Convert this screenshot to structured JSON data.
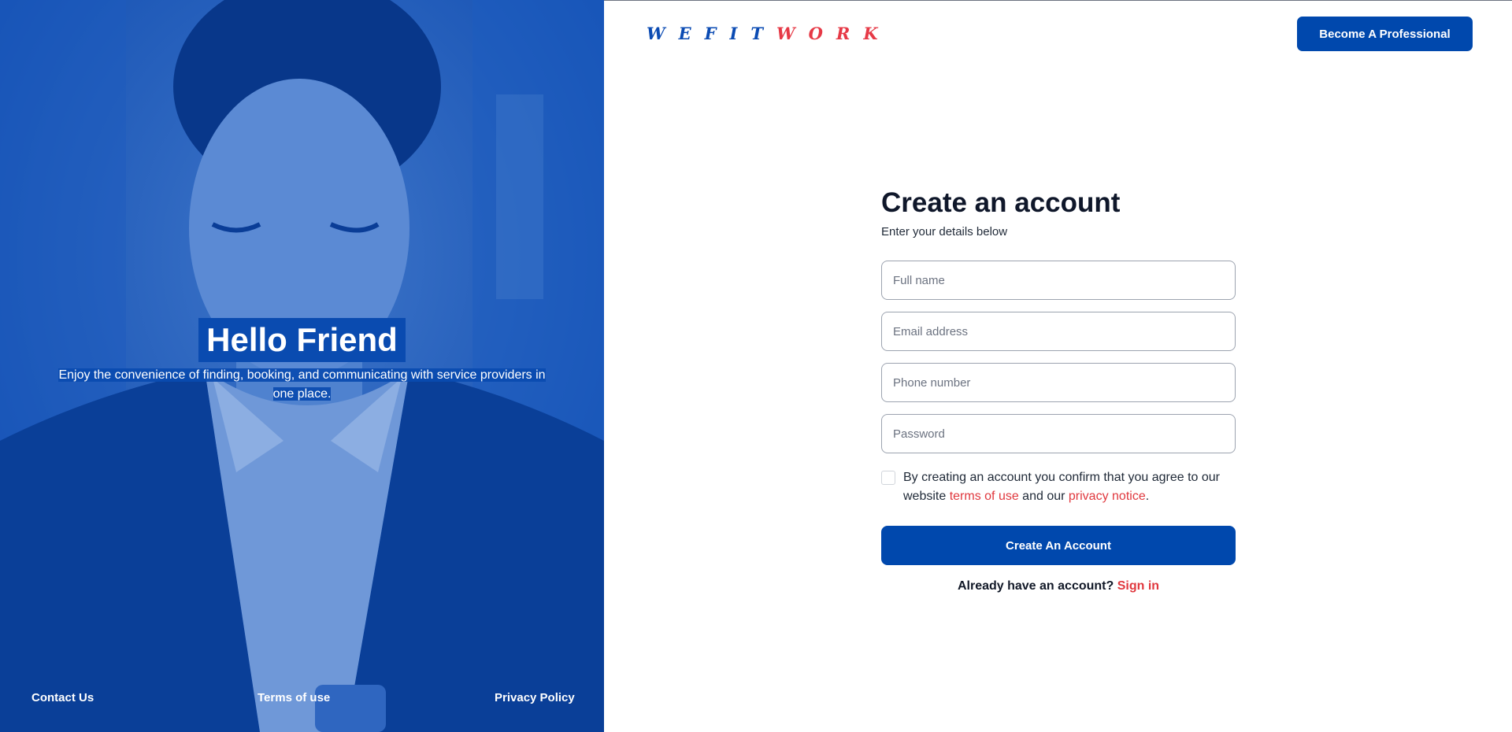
{
  "hero": {
    "title": "Hello Friend",
    "subtitle": "Enjoy the convenience of finding, booking, and communicating with service providers in one place."
  },
  "footer": {
    "contact": "Contact Us",
    "terms": "Terms of use",
    "privacy": "Privacy Policy"
  },
  "brand": {
    "letters_blue": [
      "W",
      "E",
      "F",
      "I",
      "T"
    ],
    "letters_red": [
      "W",
      "O",
      "R",
      "K"
    ],
    "blue": "#0b4bb3",
    "red": "#e63946"
  },
  "header": {
    "pro_button": "Become A Professional"
  },
  "form": {
    "title": "Create an account",
    "subtitle": "Enter your details below",
    "full_name_placeholder": "Full name",
    "email_placeholder": "Email address",
    "phone_placeholder": "Phone number",
    "password_placeholder": "Password",
    "agree_prefix": "By creating an account you confirm that you agree to our website ",
    "terms_link": "terms of use",
    "agree_mid": " and our ",
    "privacy_link": "privacy notice",
    "agree_suffix": ".",
    "submit": "Create An Account",
    "have_account": "Already have an account? ",
    "signin_link": "Sign in"
  },
  "colors": {
    "primary": "#0048ad",
    "accent_red": "#e0383e"
  }
}
